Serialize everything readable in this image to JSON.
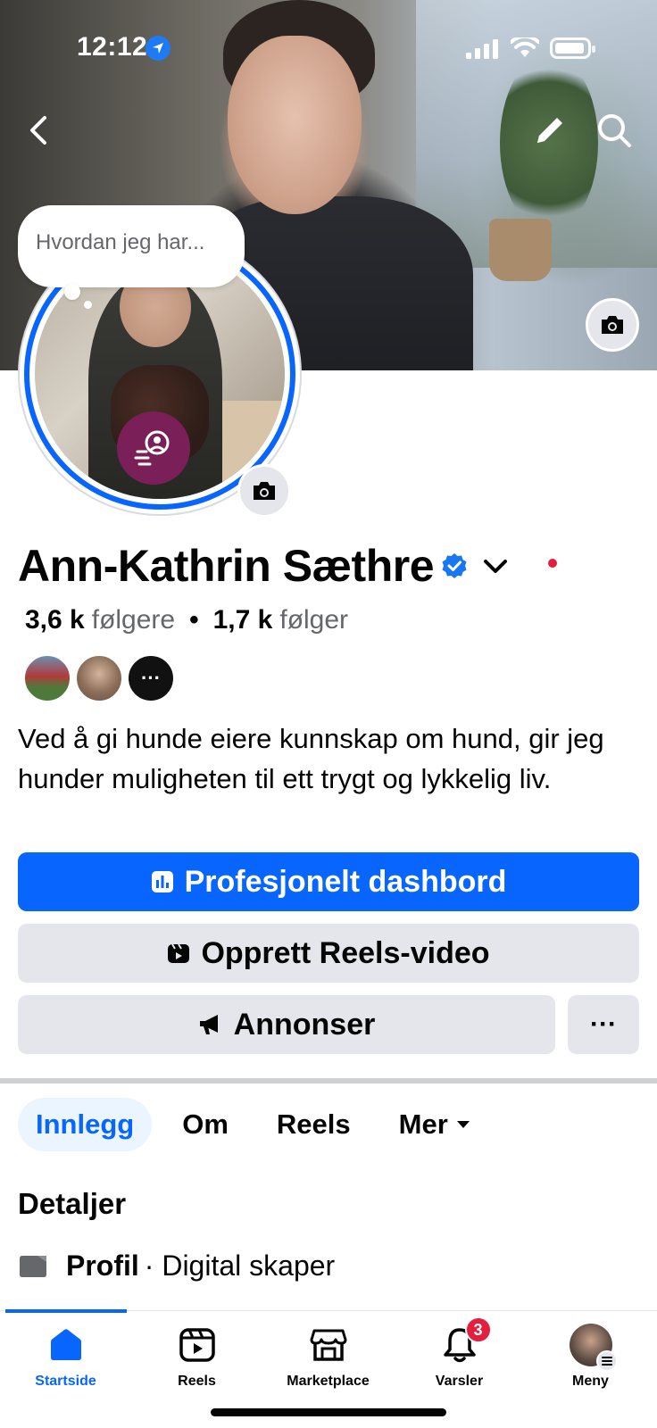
{
  "status_bar": {
    "time": "12:12"
  },
  "note": {
    "text": "Hvordan jeg har..."
  },
  "profile": {
    "name": "Ann-Kathrin Sæthre",
    "followers_count": "3,6 k",
    "followers_label": "følgere",
    "following_count": "1,7 k",
    "following_label": "følger",
    "mutual_more": "···",
    "bio": "Ved å gi hunde eiere kunnskap om hund, gir jeg hunder muligheten til ett trygt og lykkelig liv."
  },
  "actions": {
    "dashboard": "Profesjonelt dashbord",
    "reels": "Opprett Reels-video",
    "ads": "Annonser",
    "more": "···"
  },
  "tabs": [
    {
      "label": "Innlegg",
      "active": true
    },
    {
      "label": "Om"
    },
    {
      "label": "Reels"
    },
    {
      "label": "Mer"
    }
  ],
  "details": {
    "title": "Detaljer",
    "profile_label": "Profil",
    "profile_value": "· Digital skaper"
  },
  "bottom_nav": [
    {
      "label": "Startside",
      "icon": "home-icon",
      "active": true
    },
    {
      "label": "Reels",
      "icon": "reels-icon"
    },
    {
      "label": "Marketplace",
      "icon": "marketplace-icon"
    },
    {
      "label": "Varsler",
      "icon": "bell-icon",
      "badge": "3"
    },
    {
      "label": "Meny",
      "icon": "menu-avatar"
    }
  ],
  "colors": {
    "accent": "#0866ff",
    "secondary_button": "#e4e6eb",
    "notification_red": "#e41e3f",
    "badge_purple": "#7b1f58"
  }
}
